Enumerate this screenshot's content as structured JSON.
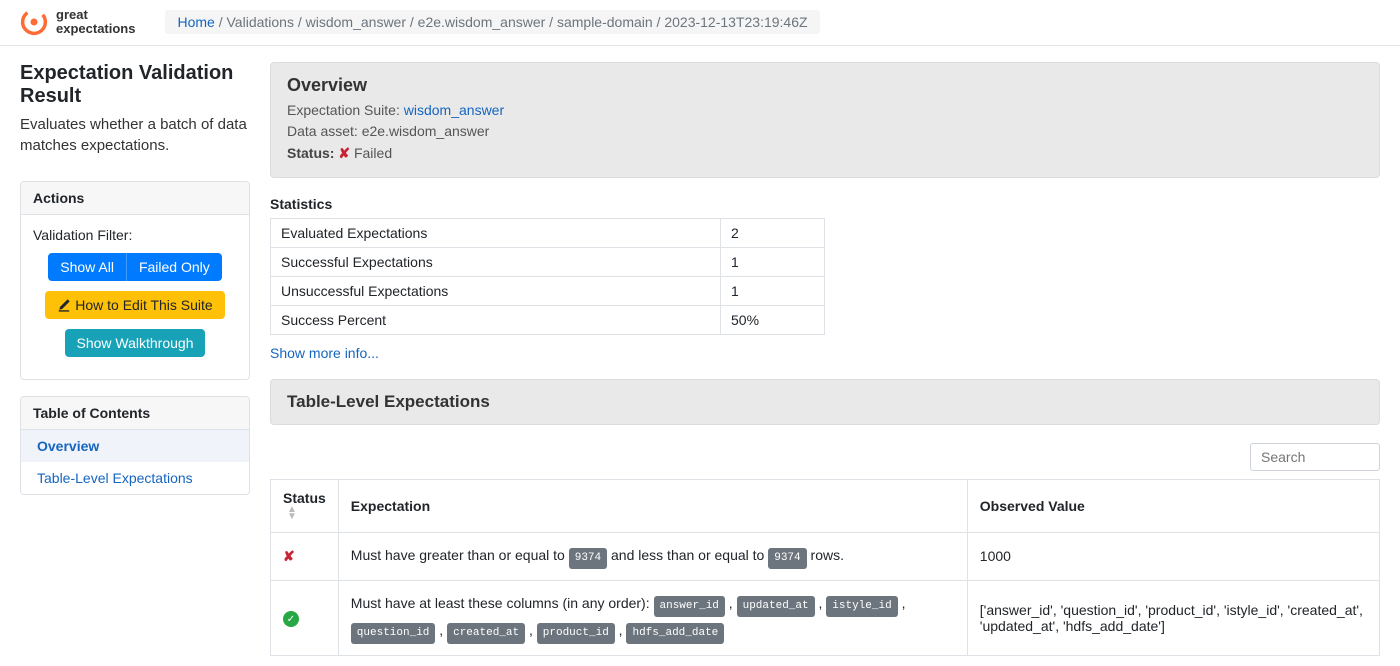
{
  "logo": {
    "line1": "great",
    "line2": "expectations"
  },
  "breadcrumb": {
    "home": "Home",
    "trail": " / Validations / wisdom_answer / e2e.wisdom_answer / sample-domain / 2023-12-13T23:19:46Z"
  },
  "sidebar": {
    "title": "Expectation Validation Result",
    "desc": "Evaluates whether a batch of data matches expectations.",
    "actions_header": "Actions",
    "filter_label": "Validation Filter:",
    "show_all": "Show All",
    "failed_only": "Failed Only",
    "how_to_edit": "How to Edit This Suite",
    "walkthrough": "Show Walkthrough",
    "toc_header": "Table of Contents",
    "toc": [
      {
        "label": "Overview",
        "active": true
      },
      {
        "label": "Table-Level Expectations",
        "active": false
      }
    ]
  },
  "overview": {
    "title": "Overview",
    "suite_label": "Expectation Suite: ",
    "suite_name": "wisdom_answer",
    "asset_label": "Data asset: ",
    "asset_name": "e2e.wisdom_answer",
    "status_label": "Status: ",
    "status_icon": "✘",
    "status_text": " Failed"
  },
  "statistics": {
    "title": "Statistics",
    "rows": [
      {
        "label": "Evaluated Expectations",
        "value": "2"
      },
      {
        "label": "Successful Expectations",
        "value": "1"
      },
      {
        "label": "Unsuccessful Expectations",
        "value": "1"
      },
      {
        "label": "Success Percent",
        "value": "50%"
      }
    ],
    "more": "Show more info..."
  },
  "tle": {
    "header": "Table-Level Expectations",
    "search_placeholder": "Search",
    "columns": {
      "status": "Status",
      "expectation": "Expectation",
      "observed": "Observed Value"
    },
    "rows": [
      {
        "pass": false,
        "exp_parts": [
          {
            "t": "text",
            "v": "Must have greater than or equal to "
          },
          {
            "t": "badge",
            "v": "9374"
          },
          {
            "t": "text",
            "v": " and less than or equal to "
          },
          {
            "t": "badge",
            "v": "9374"
          },
          {
            "t": "text",
            "v": " rows."
          }
        ],
        "observed": "1000"
      },
      {
        "pass": true,
        "exp_parts": [
          {
            "t": "text",
            "v": "Must have at least these columns (in any order): "
          },
          {
            "t": "badge",
            "v": "answer_id"
          },
          {
            "t": "text",
            "v": " , "
          },
          {
            "t": "badge",
            "v": "updated_at"
          },
          {
            "t": "text",
            "v": " , "
          },
          {
            "t": "badge",
            "v": "istyle_id"
          },
          {
            "t": "text",
            "v": " , "
          },
          {
            "t": "badge",
            "v": "question_id"
          },
          {
            "t": "text",
            "v": " , "
          },
          {
            "t": "badge",
            "v": "created_at"
          },
          {
            "t": "text",
            "v": " , "
          },
          {
            "t": "badge",
            "v": "product_id"
          },
          {
            "t": "text",
            "v": " , "
          },
          {
            "t": "badge",
            "v": "hdfs_add_date"
          }
        ],
        "observed": "['answer_id', 'question_id', 'product_id', 'istyle_id', 'created_at', 'updated_at', 'hdfs_add_date']"
      }
    ]
  }
}
